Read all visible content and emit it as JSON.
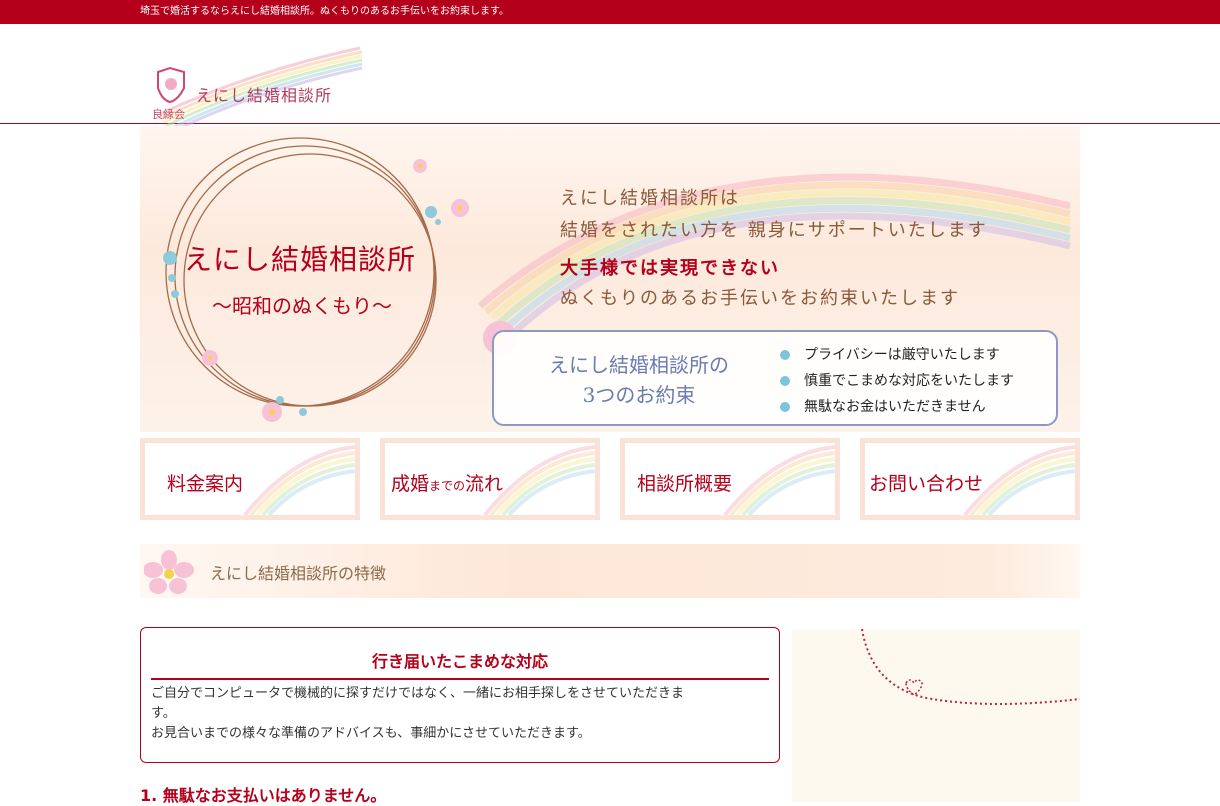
{
  "topbar": {
    "tagline": "埼玉で婚活するならえにし結婚相談所。ぬくもりのあるお手伝いをお約束します。"
  },
  "logo": {
    "name": "えにし結婚相談所",
    "sub": "良縁会"
  },
  "hero": {
    "title": "えにし結婚相談所",
    "subtitle": "〜昭和のぬくもり〜",
    "messages": [
      "えにし結婚相談所は",
      "結婚をされたい方を 親身にサポートいたします",
      "大手様では実現できない",
      "ぬくもりのあるお手伝いをお約束いたします"
    ],
    "promise_title_line1": "えにし結婚相談所の",
    "promise_title_line2": "3つのお約束",
    "promises": [
      "プライバシーは厳守いたします",
      "慎重でこまめな対応をいたします",
      "無駄なお金はいただきません"
    ]
  },
  "nav": {
    "fee": "料金案内",
    "flow_main1": "成婚",
    "flow_small": "までの",
    "flow_main2": "流れ",
    "about": "相談所概要",
    "contact": "お問い合わせ"
  },
  "section": {
    "title": "えにし結婚相談所の特徴"
  },
  "feature": {
    "title": "行き届いたこまめな対応",
    "line1": "ご自分でコンピュータで機械的に探すだけではなく、一緒にお相手探しをさせていただきま",
    "line2": "す。",
    "line3": "お見合いまでの様々な準備のアドバイスも、事細かにさせていただきます。"
  },
  "item1": "1. 無駄なお支払いはありません。",
  "colors": {
    "accent": "#b5001c",
    "promise_border": "#8a9ac4",
    "bullet": "#7ec3d8"
  },
  "icons": [
    "flower-icon",
    "heart-icon",
    "rainbow-decoration",
    "ring-decoration"
  ]
}
